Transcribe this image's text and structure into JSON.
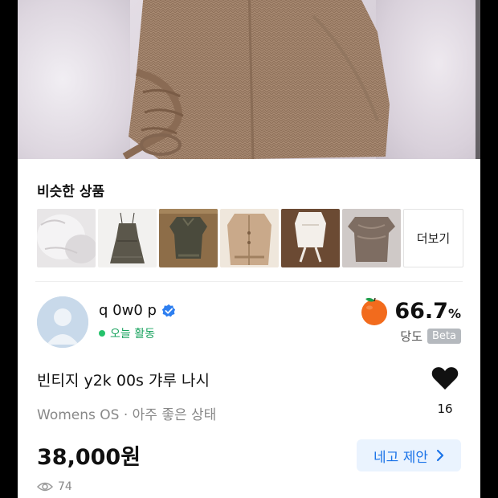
{
  "similar": {
    "title": "비슷한 상품",
    "more_label": "더보기",
    "thumbnails": [
      {
        "name": "fur-item"
      },
      {
        "name": "dark-slip-dress"
      },
      {
        "name": "lace-top"
      },
      {
        "name": "knit-cardigan"
      },
      {
        "name": "white-tie-top"
      },
      {
        "name": "ruffle-blouse"
      }
    ]
  },
  "seller": {
    "name": "q 0w0 p",
    "status": "오늘 활동",
    "rating_value": "66.7",
    "rating_unit": "%",
    "rating_label": "당도",
    "beta_label": "Beta"
  },
  "product": {
    "title": "빈티지 y2k 00s 갸루 나시",
    "subtitle": "Womens OS · 아주 좋은 상태",
    "price": "38,000원",
    "likes": "16",
    "views": "74",
    "offer_label": "네고 제안"
  },
  "colors": {
    "accent": "#1a73e8",
    "online": "#25c26b",
    "orange": "#f26b1d"
  }
}
